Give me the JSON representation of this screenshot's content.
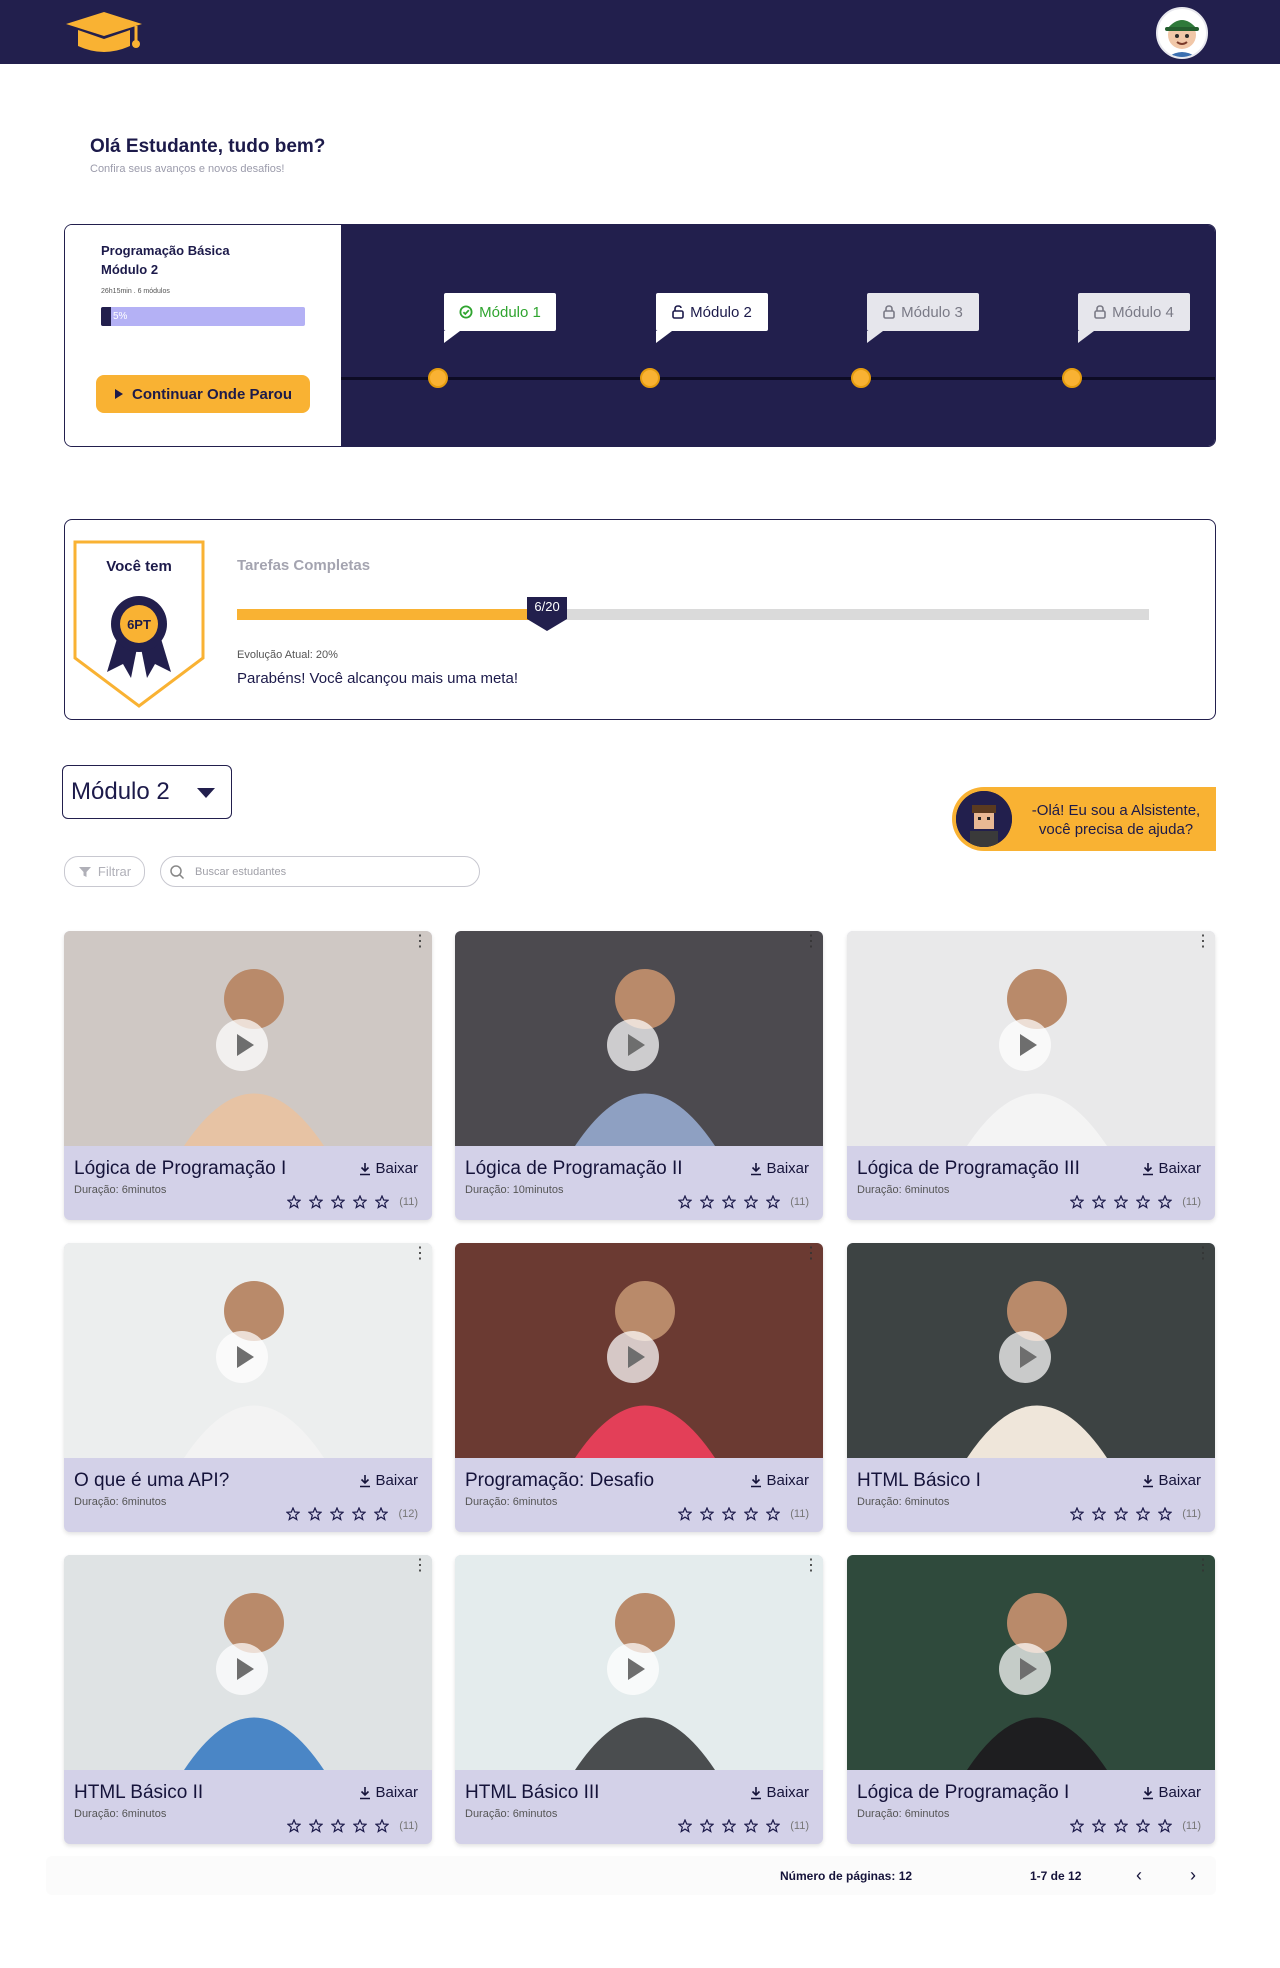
{
  "header": {
    "logo": "graduation-cap-logo",
    "avatar": "student-avatar"
  },
  "greeting": {
    "title": "Olá Estudante, tudo bem?",
    "subtitle": "Confira seus avanços e novos desafios!"
  },
  "course": {
    "name": "Programação Básica",
    "module": "Módulo 2",
    "meta": "26h15min . 6 módulos",
    "progress_label": "5%",
    "progress_value": 0.05,
    "continue_label": "Continuar Onde Parou",
    "modules": [
      {
        "label": "Módulo 1",
        "state": "done",
        "icon": "check-circle-icon"
      },
      {
        "label": "Módulo 2",
        "state": "unlocked",
        "icon": "unlock-icon"
      },
      {
        "label": "Módulo 3",
        "state": "locked",
        "icon": "lock-icon"
      },
      {
        "label": "Módulo 4",
        "state": "locked",
        "icon": "lock-icon"
      }
    ]
  },
  "tasks": {
    "badge_title": "Você tem",
    "badge_points": "6PT",
    "label": "Tarefas Completas",
    "done": 6,
    "total": 20,
    "marker_label": "6/20",
    "evolution": "Evolução Atual: 20%",
    "congrats": "Parabéns! Você alcançou mais uma meta!"
  },
  "module_select": {
    "value": "Módulo 2"
  },
  "assistant": {
    "line1": "-Olá! Eu sou a Alsistente,",
    "line2": "você precisa de ajuda?"
  },
  "filter": {
    "label": "Filtrar"
  },
  "search": {
    "placeholder": "Buscar estudantes"
  },
  "download_label": "Baixar",
  "cards": [
    {
      "title": "Lógica de Programação I",
      "duration": "Duração: 6minutos",
      "rating": 0,
      "count": "(11)",
      "bg": "#cfc8c4",
      "accent": "#e7c3a4"
    },
    {
      "title": "Lógica de Programação II",
      "duration": "Duração: 10minutos",
      "rating": 0,
      "count": "(11)",
      "bg": "#4c4a4f",
      "accent": "#8ea0c2"
    },
    {
      "title": "Lógica de Programação III",
      "duration": "Duração: 6minutos",
      "rating": 0,
      "count": "(11)",
      "bg": "#e9e9ea",
      "accent": "#f4f4f4"
    },
    {
      "title": "O que é uma API?",
      "duration": "Duração: 6minutos",
      "rating": 0,
      "count": "(12)",
      "bg": "#eceeee",
      "accent": "#f3f3f3"
    },
    {
      "title": "Programação: Desafio",
      "duration": "Duração: 6minutos",
      "rating": 0,
      "count": "(11)",
      "bg": "#6b3a32",
      "accent": "#e33f58"
    },
    {
      "title": "HTML Básico I",
      "duration": "Duração: 6minutos",
      "rating": 0,
      "count": "(11)",
      "bg": "#3d4343",
      "accent": "#efe6da"
    },
    {
      "title": "HTML Básico II",
      "duration": "Duração: 6minutos",
      "rating": 0,
      "count": "(11)",
      "bg": "#dfe3e4",
      "accent": "#4a86c6"
    },
    {
      "title": "HTML Básico III",
      "duration": "Duração: 6minutos",
      "rating": 0,
      "count": "(11)",
      "bg": "#e4eced",
      "accent": "#4a4d4f"
    },
    {
      "title": "Lógica de Programação I",
      "duration": "Duração: 6minutos",
      "rating": 0,
      "count": "(11)",
      "bg": "#2f4a3c",
      "accent": "#1e1e20"
    }
  ],
  "pager": {
    "pages": "Número de páginas: 12",
    "range": "1-7 de 12",
    "prev": "‹",
    "next": "›"
  }
}
